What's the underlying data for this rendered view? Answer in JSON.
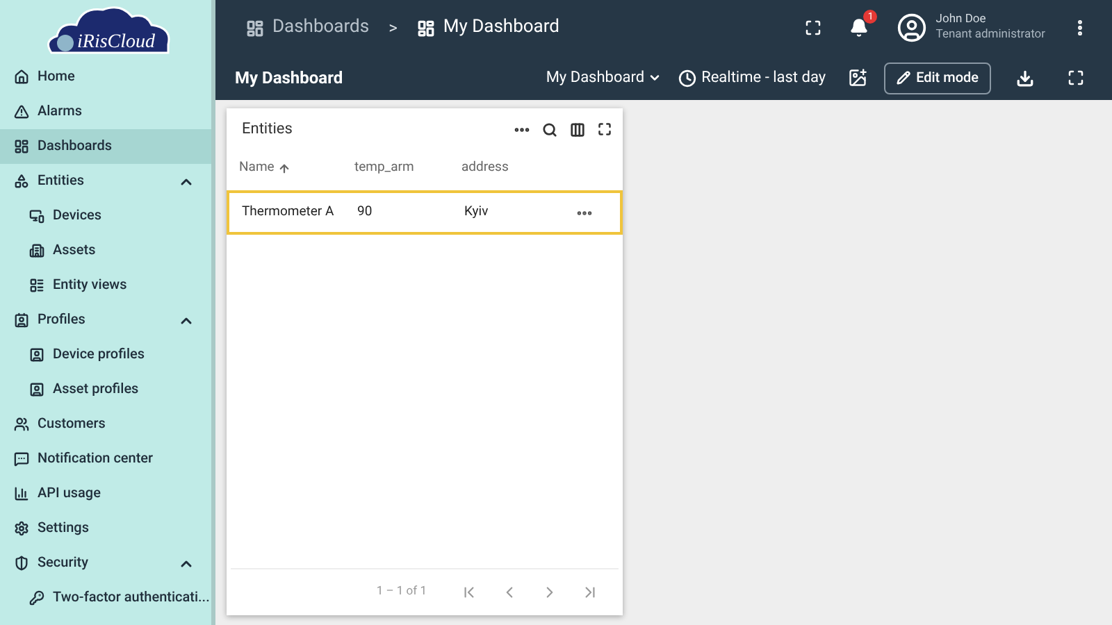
{
  "logo": {
    "text": "iRisCloud"
  },
  "sidebar": {
    "items": [
      {
        "label": "Home",
        "selected": false
      },
      {
        "label": "Alarms",
        "selected": false
      },
      {
        "label": "Dashboards",
        "selected": true
      },
      {
        "label": "Entities",
        "selected": false,
        "expanded": true,
        "children": [
          {
            "label": "Devices",
            "selected": false
          },
          {
            "label": "Assets",
            "selected": false
          },
          {
            "label": "Entity views",
            "selected": false
          }
        ]
      },
      {
        "label": "Profiles",
        "selected": false,
        "expanded": true,
        "children": [
          {
            "label": "Device profiles",
            "selected": false
          },
          {
            "label": "Asset profiles",
            "selected": false
          }
        ]
      },
      {
        "label": "Customers",
        "selected": false
      },
      {
        "label": "Notification center",
        "selected": false
      },
      {
        "label": "API usage",
        "selected": false
      },
      {
        "label": "Settings",
        "selected": false
      },
      {
        "label": "Security",
        "selected": false,
        "expanded": true,
        "children": [
          {
            "label": "Two-factor authenticati...",
            "selected": false
          }
        ]
      }
    ]
  },
  "breadcrumb": [
    "Dashboards",
    ">",
    "My Dashboard"
  ],
  "notifications": {
    "count": "1"
  },
  "user": {
    "name": "John Doe",
    "role": "Tenant administrator"
  },
  "toolbar": {
    "title": "My Dashboard",
    "dashboard_select": "My Dashboard",
    "timewindow": "Realtime - last day",
    "edit_button": "Edit mode"
  },
  "widget": {
    "title": "Entities",
    "columns": [
      {
        "label": "Name",
        "sorted": true
      },
      {
        "label": "temp_arm",
        "sorted": false
      },
      {
        "label": "address",
        "sorted": false
      }
    ],
    "rows": [
      {
        "cells": [
          "Thermometer A",
          "90",
          "Kyiv"
        ],
        "selected": true
      }
    ],
    "pagination": "1 – 1 of 1"
  }
}
